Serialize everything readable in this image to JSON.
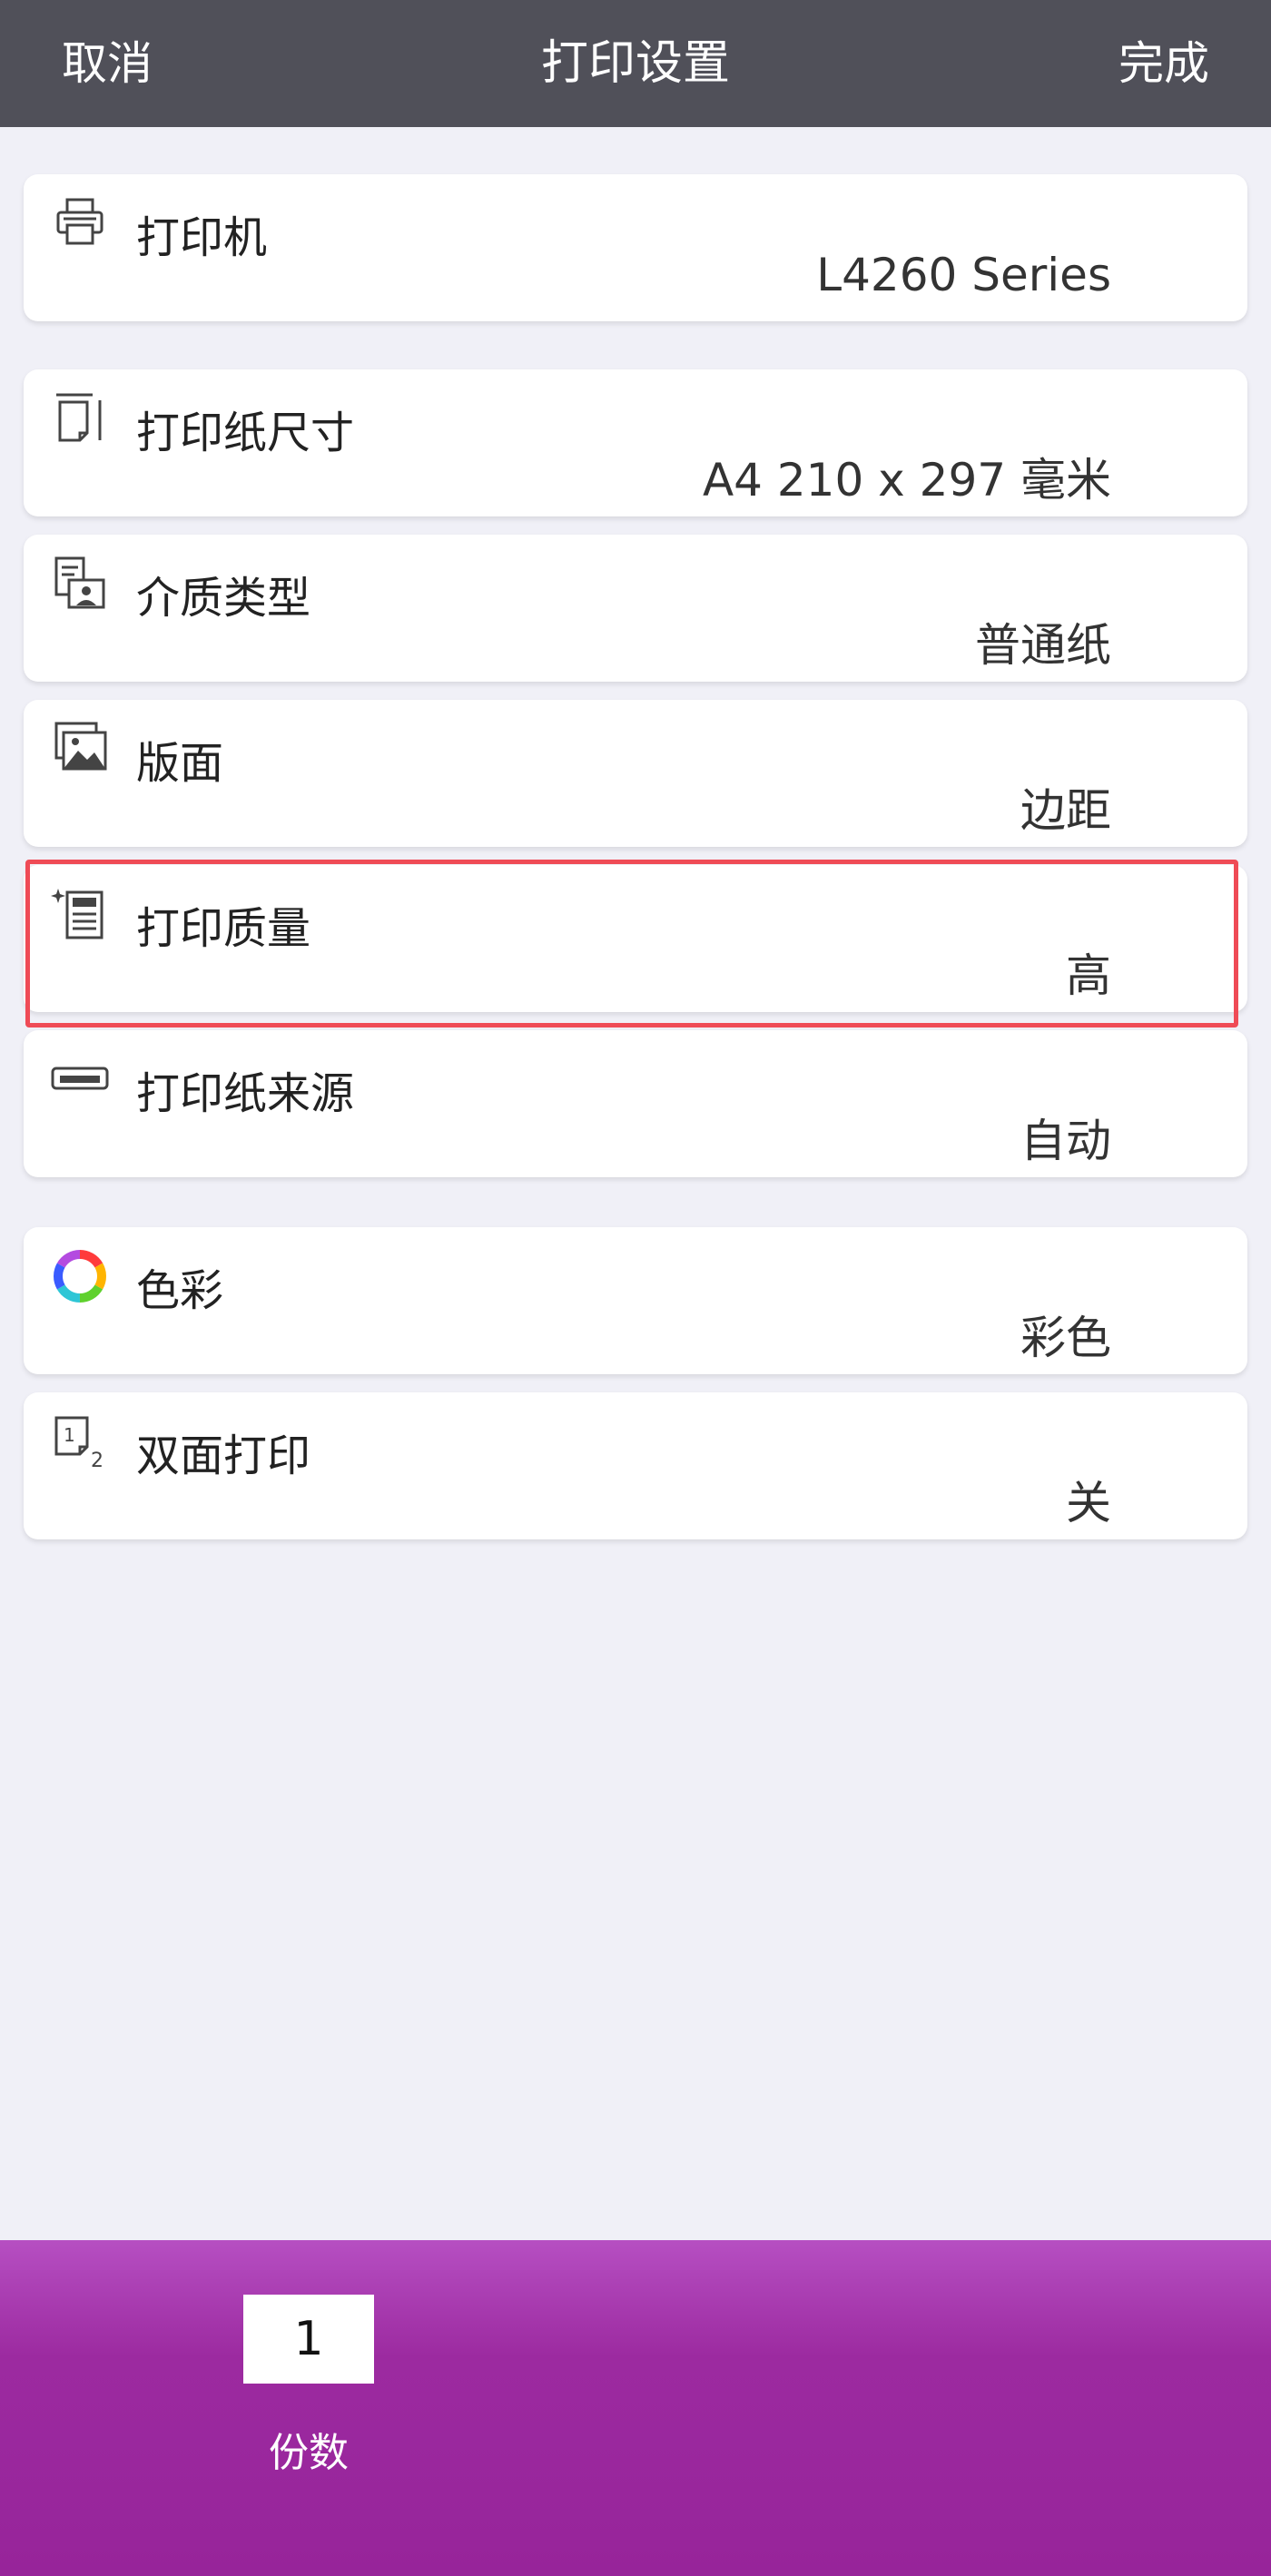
{
  "header": {
    "cancel": "取消",
    "title": "打印设置",
    "done": "完成"
  },
  "settings": [
    {
      "label": "打印机",
      "value": "L4260 Series",
      "icon": "printer-icon"
    },
    {
      "label": "打印纸尺寸",
      "value": "A4 210 x 297 毫米",
      "icon": "paper-size-icon"
    },
    {
      "label": "介质类型",
      "value": "普通纸",
      "icon": "media-type-icon"
    },
    {
      "label": "版面",
      "value": "边距",
      "icon": "layout-icon"
    },
    {
      "label": "打印质量",
      "value": "高",
      "icon": "print-quality-icon"
    },
    {
      "label": "打印纸来源",
      "value": "自动",
      "icon": "paper-source-icon"
    },
    {
      "label": "色彩",
      "value": "彩色",
      "icon": "color-wheel-icon"
    },
    {
      "label": "双面打印",
      "value": "关",
      "icon": "duplex-icon"
    }
  ],
  "footer": {
    "copies_value": "1",
    "copies_label": "份数"
  },
  "colors": {
    "header_bg": "#505059",
    "footer_bg": "#97249a",
    "highlight": "#ef4b56"
  }
}
